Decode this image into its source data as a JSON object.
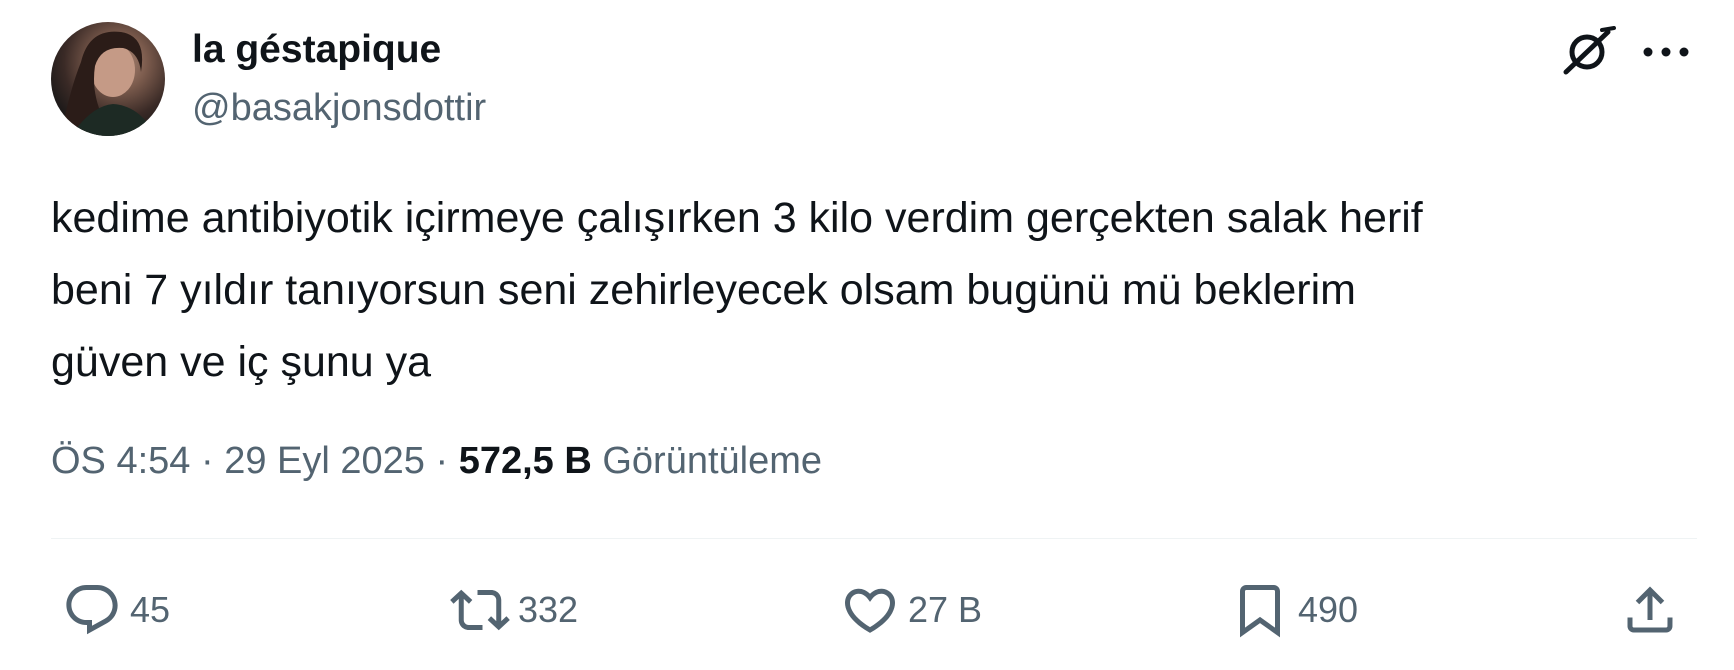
{
  "author": {
    "display_name": "la géstapique",
    "handle": "@basakjonsdottir",
    "avatar_icon": "profile-photo"
  },
  "header_actions": {
    "grok_icon": "grok-icon",
    "more_icon": "more-icon"
  },
  "tweet": {
    "text": "kedime antibiyotik içirmeye çalışırken 3 kilo verdim gerçekten salak herif\nbeni 7 yıldır tanıyorsun seni zehirleyecek olsam bugünü mü beklerim\ngüven ve iç şunu ya",
    "time": "ÖS 4:54",
    "separator": "·",
    "date": "29 Eyl 2025",
    "views_count": "572,5 B",
    "views_label": "Görüntüleme"
  },
  "actions": {
    "reply": {
      "icon": "reply-icon",
      "count": "45"
    },
    "retweet": {
      "icon": "retweet-icon",
      "count": "332"
    },
    "like": {
      "icon": "heart-icon",
      "count": "27 B"
    },
    "bookmark": {
      "icon": "bookmark-icon",
      "count": "490"
    },
    "share": {
      "icon": "share-icon"
    }
  },
  "colors": {
    "text_primary": "#0f1419",
    "text_secondary": "#536471",
    "divider": "#eff3f4"
  }
}
